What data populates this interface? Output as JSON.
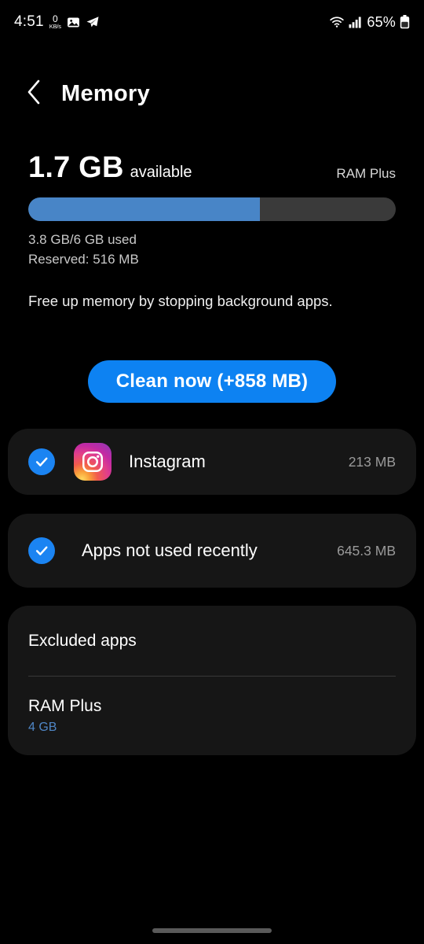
{
  "status_bar": {
    "time": "4:51",
    "data_rate_value": "0",
    "data_rate_unit": "KB/s",
    "icons_left": [
      "photos-icon",
      "telegram-icon"
    ],
    "wifi_icon": "wifi-icon",
    "signal_icon": "cellular-signal-icon",
    "battery_percent": "65%",
    "battery_icon": "battery-icon"
  },
  "header": {
    "back_icon": "back-chevron-icon",
    "title": "Memory"
  },
  "summary": {
    "available_value": "1.7 GB",
    "available_label": "available",
    "ram_plus_tag": "RAM Plus",
    "usage_text": "3.8 GB/6 GB used",
    "reserved_text": "Reserved: 516 MB",
    "bar_percent": 63,
    "bar_fill_color": "#4885c7",
    "bar_track_color": "#3a3a3a",
    "hint": "Free up memory by stopping background apps."
  },
  "clean_button": {
    "label": "Clean now (+858 MB)",
    "color": "#0d82f2"
  },
  "app_list": [
    {
      "name": "Instagram",
      "size": "213 MB",
      "checked": true,
      "icon": "instagram-icon",
      "has_app_icon": true
    },
    {
      "name": "Apps not used recently",
      "size": "645.3 MB",
      "checked": true,
      "icon": "none",
      "has_app_icon": false
    }
  ],
  "excluded_card": {
    "title": "Excluded apps",
    "item_title": "RAM Plus",
    "item_subtitle": "4 GB",
    "subtitle_color": "#4f86c6"
  }
}
